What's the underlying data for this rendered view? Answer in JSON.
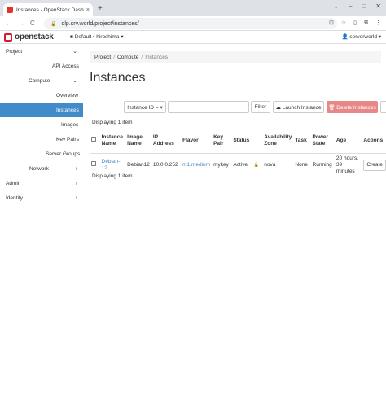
{
  "browser": {
    "tab_title": "Instances - OpenStack Dashboard",
    "tab_close": "×",
    "new_tab": "+",
    "window_controls": [
      "⌄",
      "–",
      "□",
      "✕"
    ],
    "nav_back": "←",
    "nav_forward": "→",
    "nav_reload": "C",
    "lock": "🔒",
    "url": "dlp.srv.world/project/instances/",
    "addr_icons": [
      "⊡",
      "☆",
      "▯",
      "⧉",
      "⋮"
    ]
  },
  "header": {
    "logo_text": "openstack",
    "project_selector": "■ Default • hiroshima ▾",
    "user_menu": "👤 serverworld ▾"
  },
  "sidebar": {
    "items": [
      {
        "label": "Project",
        "chevron": "⌄"
      },
      {
        "label": "API Access"
      },
      {
        "label": "Compute",
        "chevron": "⌄"
      },
      {
        "label": "Overview"
      },
      {
        "label": "Instances"
      },
      {
        "label": "Images"
      },
      {
        "label": "Key Pairs"
      },
      {
        "label": "Server Groups"
      },
      {
        "label": "Network",
        "chevron": "›"
      },
      {
        "label": "Admin",
        "chevron": "›"
      },
      {
        "label": "Identity",
        "chevron": "›"
      }
    ]
  },
  "breadcrumb": {
    "items": [
      "Project",
      "Compute",
      "Instances"
    ],
    "separator": "/"
  },
  "page_title": "Instances",
  "toolbar": {
    "filter_field_select": "Instance ID = ▾",
    "search_placeholder": "",
    "filter_label": "Filter",
    "launch_label": "☁ Launch Instance",
    "delete_label": "🗑 Delete Instances"
  },
  "display_count_top": "Displaying 1 item",
  "display_count_bottom": "Displaying 1 item",
  "table": {
    "headers": [
      "Instance Name",
      "Image Name",
      "IP Address",
      "Flavor",
      "Key Pair",
      "Status",
      "",
      "Availability Zone",
      "Task",
      "Power State",
      "Age",
      "Actions"
    ],
    "rows": [
      {
        "instance_name": "Debian-12",
        "image_name": "Debian12",
        "ip": "10.0.0.252",
        "flavor": "m1.medium",
        "key_pair": "mykey",
        "status": "Active",
        "lock_icon": "🔓",
        "zone": "nova",
        "task": "None",
        "power": "Running",
        "age": "20 hours, 39 minutes",
        "action": "Create"
      }
    ]
  }
}
